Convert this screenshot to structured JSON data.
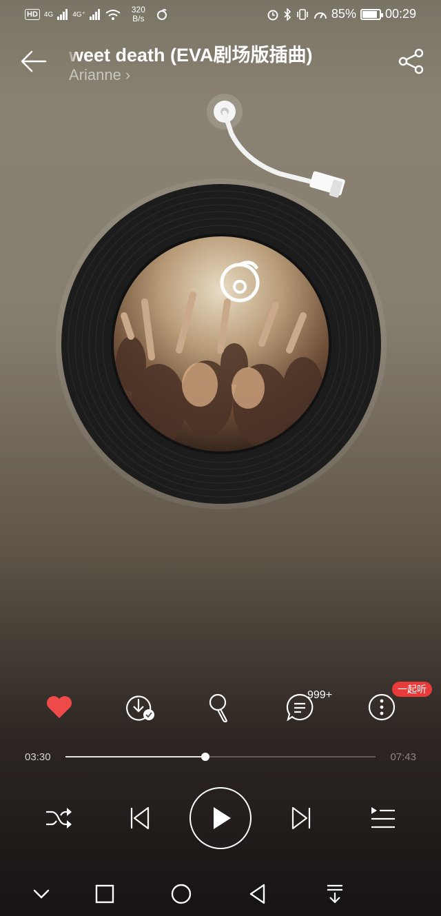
{
  "status_bar": {
    "hd": "HD",
    "signal_1": "4G",
    "signal_2": "4G⁺",
    "speed_value": "320",
    "speed_unit": "B/s",
    "battery": "85%",
    "time": "00:29"
  },
  "header": {
    "title": "weet death (EVA剧场版插曲)",
    "artist": "Arianne",
    "artist_chevron": "›"
  },
  "actions": {
    "comment_count": "999+",
    "together_badge": "一起听",
    "icons": [
      "heart-icon",
      "download-icon",
      "microphone-icon",
      "comment-icon",
      "more-icon"
    ]
  },
  "progress": {
    "current": "03:30",
    "total": "07:43",
    "fraction": 0.45
  },
  "colors": {
    "accent": "#ea3b3b",
    "heart": "#ee4a4a"
  },
  "controls": {
    "icons": [
      "shuffle-icon",
      "previous-icon",
      "play-icon",
      "next-icon",
      "playlist-icon"
    ]
  },
  "navbar": {
    "icons": [
      "collapse-icon",
      "recent-apps-icon",
      "home-icon",
      "back-icon",
      "notification-pull-icon"
    ]
  }
}
